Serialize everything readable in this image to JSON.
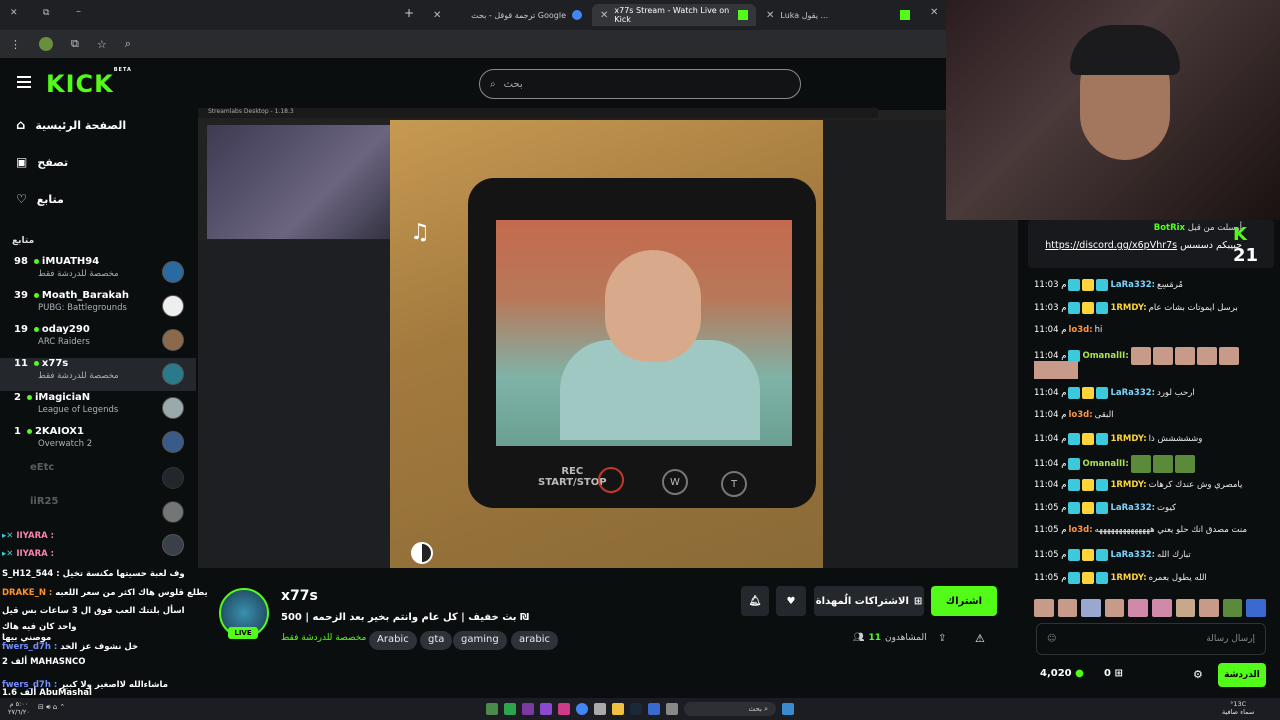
{
  "browser": {
    "tabs": [
      {
        "title": "ترجمة قوقل - بحث Google"
      },
      {
        "title": "x77s Stream - Watch Live on Kick"
      },
      {
        "title": "Luka يقول ..."
      }
    ],
    "new_tab": "+"
  },
  "kick": {
    "logo": "KICK",
    "logo_badge": "BETA",
    "search_placeholder": "بحث",
    "nav": [
      {
        "label": "الصفحة الرئيسية",
        "icon": "home-icon"
      },
      {
        "label": "تصفح",
        "icon": "browse-icon"
      },
      {
        "label": "متابع",
        "icon": "heart-icon"
      }
    ],
    "followed_heading": "متابع",
    "channels": [
      {
        "count": "98",
        "name": "iMUATH94",
        "sub": "مخصصة للدردشة فقط"
      },
      {
        "count": "39",
        "name": "Moath_Barakah",
        "sub": "PUBG: Battlegrounds"
      },
      {
        "count": "19",
        "name": "oday290",
        "sub": "ARC Raiders"
      },
      {
        "count": "11",
        "name": "x77s",
        "sub": "مخصصة للدردشة فقط"
      },
      {
        "count": "2",
        "name": "iMagiciaN",
        "sub": "League of Legends"
      },
      {
        "count": "1",
        "name": "2KAIOX1",
        "sub": "Overwatch 2"
      },
      {
        "count": "",
        "name": "eEtc",
        "sub": ""
      },
      {
        "count": "",
        "name": "iiR25",
        "sub": ""
      }
    ]
  },
  "overlay_chat": [
    {
      "user": "IIYARA :",
      "text": ""
    },
    {
      "user": "IIYARA :",
      "text": ""
    },
    {
      "user": "S_H12_544 :",
      "text": "وف لعبة حسيتها مكنسة تخيل"
    },
    {
      "user": "DRAKE_N :",
      "text": "يطلع قلوس هاك اكثر من سعر اللعبه"
    },
    {
      "user": "",
      "text": "اسأل بلتتك العب فوق ال 3 ساعات بس قيل"
    },
    {
      "user": "",
      "text": "واحد كان فيه هاك"
    },
    {
      "user": "",
      "text": "موصني بيها"
    },
    {
      "user": "fwers_d7h :",
      "text": "خل نشوف عز الخد"
    },
    {
      "user": "MAHASNCO",
      "text": "2 ألف"
    },
    {
      "user": "fwers_d7h :",
      "text": "ماشاءالله لااصغير ولا كبير"
    },
    {
      "user": "AbuMashal",
      "text": "1.6 ألف"
    }
  ],
  "stream": {
    "name": "x77s",
    "live": "LIVE",
    "title": "بث خفيف | كل عام وانتم بخير بعد الزحمه | 500 ₪",
    "category": "مخصصة للدردشة فقط",
    "tags": [
      "Arabic",
      "gta",
      "gaming",
      "arabic"
    ],
    "subscribe": "اشتراك",
    "gift_subs": "الاشتراكات الُمهداة",
    "viewers_label": "المشاهدون",
    "viewers_count": "11",
    "video_window_title": "Streamlabs Desktop - 1.18.3",
    "device_labels": {
      "rec": "REC",
      "startstop": "START/STOP",
      "w": "W",
      "t": "T"
    }
  },
  "chat": {
    "pinned_user": "BotRix",
    "pinned_prefix": "أرسلت من قبل",
    "pinned_link": "https://discord.gg/x6pVhr7s",
    "pinned_text": "حبيبكم دسسس",
    "messages": [
      {
        "time": "11:03 م",
        "user": "LaRa332:",
        "color": "#7dd3fc",
        "text": "مُرمَسِع"
      },
      {
        "time": "11:03 م",
        "user": "1RMDY:",
        "color": "#ffd43b",
        "text": "برسل ايموتات بشات عام"
      },
      {
        "time": "11:04 م",
        "user": "lo3d:",
        "color": "#fd9644",
        "text": "hi"
      },
      {
        "time": "11:04 م",
        "user": "OmanalII:",
        "color": "#a9e34b",
        "text": ""
      },
      {
        "time": "11:04 م",
        "user": "LaRa332:",
        "color": "#7dd3fc",
        "text": "ارحب لورد"
      },
      {
        "time": "11:04 م",
        "user": "lo3d:",
        "color": "#fd9644",
        "text": "البقى"
      },
      {
        "time": "11:04 م",
        "user": "1RMDY:",
        "color": "#ffd43b",
        "text": "وششششش ذا"
      },
      {
        "time": "11:04 م",
        "user": "OmanalII:",
        "color": "#a9e34b",
        "text": ""
      },
      {
        "time": "11:04 م",
        "user": "1RMDY:",
        "color": "#ffd43b",
        "text": "يامصري وش عندك كرهات"
      },
      {
        "time": "11:05 م",
        "user": "LaRa332:",
        "color": "#7dd3fc",
        "text": "كيوت"
      },
      {
        "time": "11:05 م",
        "user": "lo3d:",
        "color": "#fd9644",
        "text": "منت مصدق انك حلو يعني ههههههههههههههه"
      },
      {
        "time": "11:05 م",
        "user": "LaRa332:",
        "color": "#7dd3fc",
        "text": "تبارك الله"
      },
      {
        "time": "11:05 م",
        "user": "1RMDY:",
        "color": "#ffd43b",
        "text": "الله يطول بعمره"
      }
    ],
    "input_placeholder": "إرسال رسالة",
    "send_button": "الدردشة",
    "points": "4,020",
    "gifts": "0",
    "viewer_badge": "21"
  },
  "taskbar": {
    "search": "بحث",
    "weather": "°13C",
    "weather_desc": "سماء صافية",
    "time": "٥:٠٠ م",
    "date": "٢٧/٦/٢٠"
  },
  "colors": {
    "brand": "#53fc18",
    "bg": "#0b0e0f",
    "panel": "#24272c"
  }
}
